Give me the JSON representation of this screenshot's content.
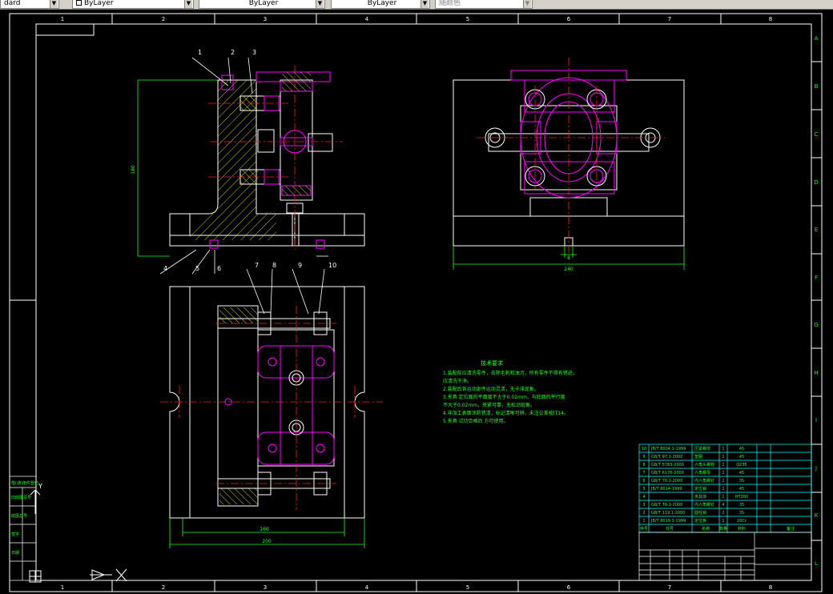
{
  "toolbar": {
    "combos": [
      {
        "label": "dard",
        "has_swatch": false
      },
      {
        "label": "ByLayer",
        "has_swatch": true
      },
      {
        "label": "ByLayer",
        "has_swatch": false
      },
      {
        "label": "ByLayer",
        "has_swatch": false
      },
      {
        "label": "随颜色",
        "has_swatch": false
      }
    ]
  },
  "frame": {
    "columns": [
      "1",
      "2",
      "3",
      "4",
      "5",
      "6",
      "7",
      "8"
    ],
    "rows": [
      "A",
      "B",
      "C",
      "D",
      "E",
      "F",
      "G",
      "H",
      "I",
      "J",
      "K",
      "L"
    ]
  },
  "dimensions": {
    "front_height": "180",
    "side_width": "240",
    "side_slot": "8",
    "top_inner": "160",
    "top_outer": "200"
  },
  "callouts": [
    "1",
    "2",
    "3",
    "4",
    "5",
    "6",
    "7",
    "8",
    "9",
    "10"
  ],
  "notes": {
    "title": "技术要求",
    "lines": [
      "1.装配前应清洗零件，去除毛刺和油污，所有零件不得有锈迹。",
      "应清洗干净。",
      "2.装配后各运动部件运动灵活，无卡滞现象。",
      "3.夹具 定位面的平面度不大于0.02mm，与底面的平行度",
      "不大于0.02mm，夹紧可靠，无松动现象。",
      "4.非加工表面涂防锈漆，标记清晰可辨，未注公差按IT14。",
      "5.夹具 试切合格后 方可使用。"
    ]
  },
  "bom": {
    "rows": [
      {
        "no": "10",
        "code": "JB/T 8004.1-1999",
        "name": "压紧螺母",
        "qty": "1",
        "mat": "45"
      },
      {
        "no": "9",
        "code": "GB/T 97.1-2002",
        "name": "垫圈",
        "qty": "2",
        "mat": "45"
      },
      {
        "no": "8",
        "code": "GB/T 5783-2000",
        "name": "六角头螺栓",
        "qty": "2",
        "mat": "Q235"
      },
      {
        "no": "7",
        "code": "GB/T 6170-2000",
        "name": "六角螺母",
        "qty": "2",
        "mat": "45"
      },
      {
        "no": "6",
        "code": "GB/T 70.1-2000",
        "name": "内六角螺钉",
        "qty": "2",
        "mat": "35"
      },
      {
        "no": "5",
        "code": "JB/T 8014-1999",
        "name": "定位销",
        "qty": "2",
        "mat": "45"
      },
      {
        "no": "4",
        "code": "",
        "name": "夹具体",
        "qty": "1",
        "mat": "HT200"
      },
      {
        "no": "3",
        "code": "GB/T 70.1-2000",
        "name": "内六角螺钉",
        "qty": "4",
        "mat": "35"
      },
      {
        "no": "2",
        "code": "GB/T 119.1-2000",
        "name": "圆柱销",
        "qty": "2",
        "mat": "35"
      },
      {
        "no": "1",
        "code": "JB/T 8019.1-1999",
        "name": "定位板",
        "qty": "1",
        "mat": "20Cr"
      }
    ],
    "header": [
      "序号",
      "代号",
      "名称",
      "数量",
      "材料",
      "备注"
    ]
  },
  "left_panel": [
    "借(通)用件登记",
    "旧底图总号",
    "底图总号",
    "签字",
    "日期"
  ],
  "colors": {
    "frame": "#ffffff",
    "part": "#ffffff",
    "magenta": "#ff00ff",
    "green": "#22ff22",
    "red": "#ff2020",
    "yellow": "#ffff00",
    "cyan": "#00ffff",
    "hatch": "#ffff00"
  }
}
